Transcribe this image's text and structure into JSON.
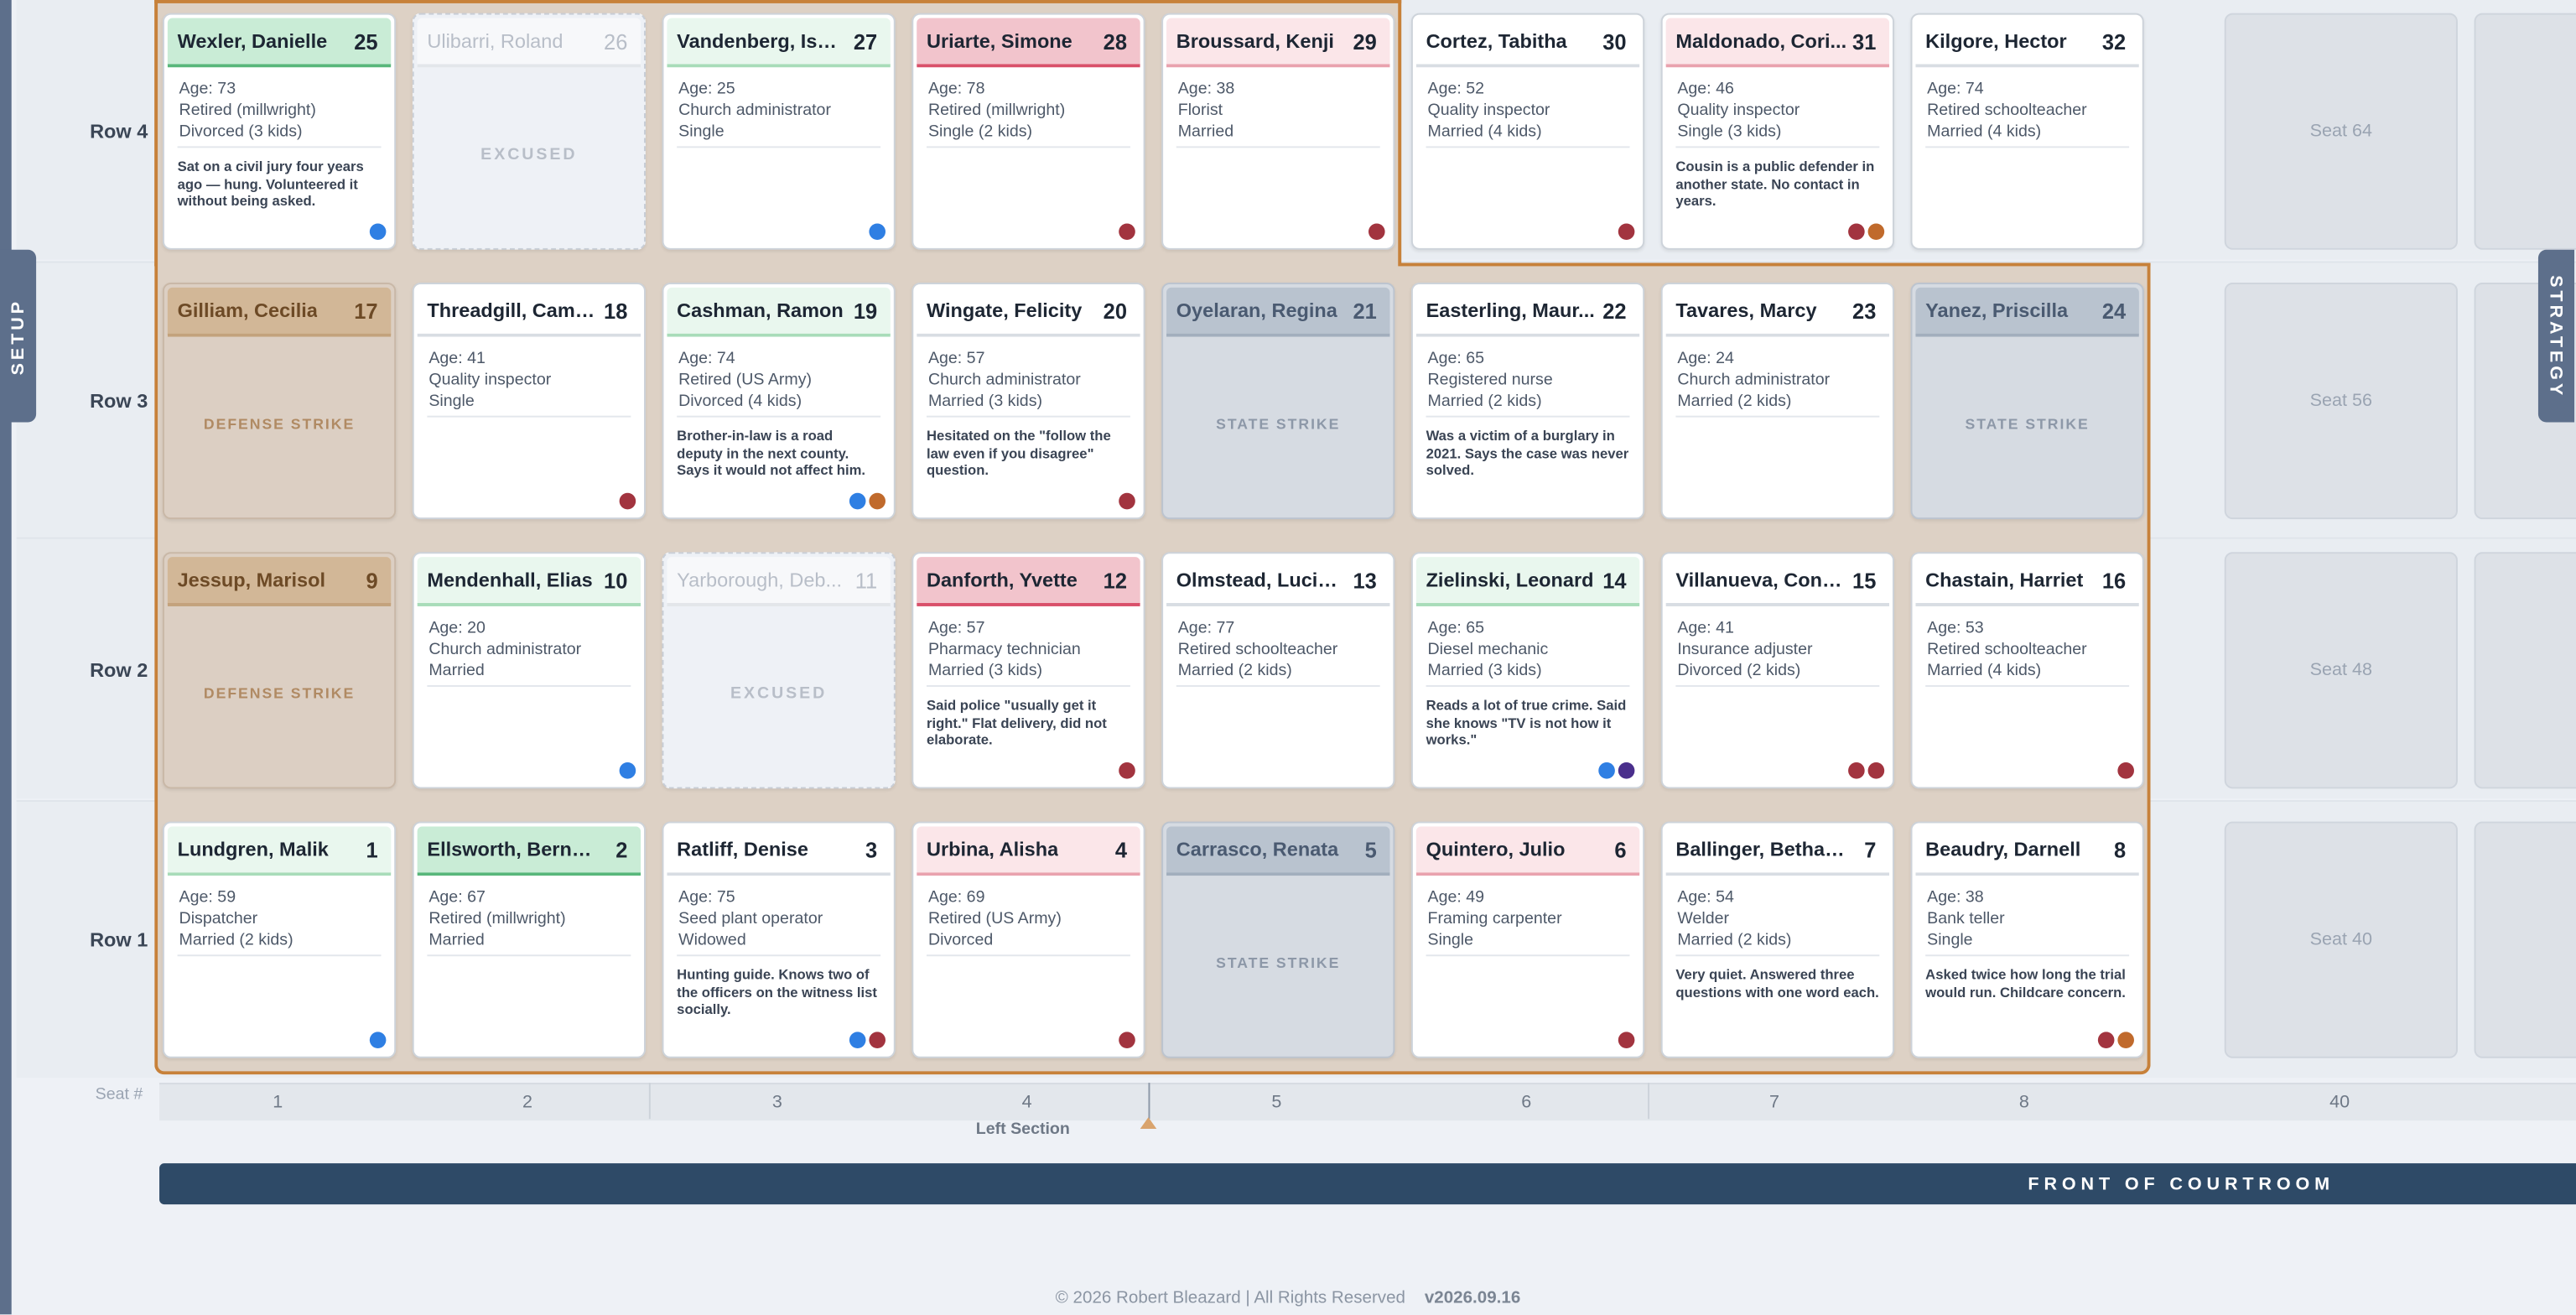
{
  "side_tabs": {
    "setup": "SETUP",
    "strategy": "STRATEGY"
  },
  "rows": [
    "Row 4",
    "Row 3",
    "Row 2",
    "Row 1"
  ],
  "seat_header": "Seat #",
  "section_label": "Left Section",
  "front_label": "FRONT OF COURTROOM",
  "footer": {
    "copyright": "© 2026 Robert Bleazard | All Rights Reserved",
    "version": "v2026.09.16"
  },
  "strike_labels": {
    "defense": "DEFENSE STRIKE",
    "state": "STATE STRIKE",
    "excused": "EXCUSED"
  },
  "dot_colors": {
    "blue": "#2f7fe3",
    "red": "#a2343f",
    "orange": "#c06a2c",
    "purple": "#4a2f8c"
  },
  "seat_columns": [
    "1",
    "2",
    "3",
    "4",
    "5",
    "6",
    "7",
    "8",
    "40"
  ],
  "empty_seats": [
    {
      "label": "Seat 64"
    },
    {
      "label": "Seat 56"
    },
    {
      "label": "Seat 48"
    },
    {
      "label": "Seat 40"
    }
  ],
  "jurors": [
    {
      "name": "Wexler, Danielle",
      "num": "25",
      "status": "normal",
      "color": "green",
      "age": "Age: 73",
      "job": "Retired (millwright)",
      "family": "Divorced (3 kids)",
      "note": "Sat on a civil jury four years ago — hung. Volunteered it without being asked.",
      "dots": [
        "blue"
      ]
    },
    {
      "name": "Ulibarri, Roland",
      "num": "26",
      "status": "excused"
    },
    {
      "name": "Vandenberg, Isai...",
      "num": "27",
      "status": "normal",
      "color": "lgreen",
      "age": "Age: 25",
      "job": "Church administrator",
      "family": "Single",
      "note": "",
      "dots": [
        "blue"
      ]
    },
    {
      "name": "Uriarte, Simone",
      "num": "28",
      "status": "normal",
      "color": "red",
      "age": "Age: 78",
      "job": "Retired (millwright)",
      "family": "Single (2 kids)",
      "note": "",
      "dots": [
        "red"
      ]
    },
    {
      "name": "Broussard, Kenji",
      "num": "29",
      "status": "normal",
      "color": "pink",
      "age": "Age: 38",
      "job": "Florist",
      "family": "Married",
      "note": "",
      "dots": [
        "red"
      ]
    },
    {
      "name": "Cortez, Tabitha",
      "num": "30",
      "status": "normal",
      "color": "white",
      "age": "Age: 52",
      "job": "Quality inspector",
      "family": "Married (4 kids)",
      "note": "",
      "dots": [
        "red"
      ]
    },
    {
      "name": "Maldonado, Cori...",
      "num": "31",
      "status": "normal",
      "color": "pink",
      "age": "Age: 46",
      "job": "Quality inspector",
      "family": "Single (3 kids)",
      "note": "Cousin is a public defender in another state. No contact in years.",
      "dots": [
        "red",
        "orange"
      ]
    },
    {
      "name": "Kilgore, Hector",
      "num": "32",
      "status": "normal",
      "color": "white",
      "age": "Age: 74",
      "job": "Retired schoolteacher",
      "family": "Married (4 kids)",
      "note": "",
      "dots": []
    },
    {
      "name": "Gilliam, Cecilia",
      "num": "17",
      "status": "defense"
    },
    {
      "name": "Threadgill, Camille",
      "num": "18",
      "status": "normal",
      "color": "white",
      "age": "Age: 41",
      "job": "Quality inspector",
      "family": "Single",
      "note": "",
      "dots": [
        "red"
      ]
    },
    {
      "name": "Cashman, Ramon",
      "num": "19",
      "status": "normal",
      "color": "lgreen",
      "age": "Age: 74",
      "job": "Retired (US Army)",
      "family": "Divorced (4 kids)",
      "note": "Brother-in-law is a road deputy in the next county. Says it would not affect him.",
      "dots": [
        "blue",
        "orange"
      ]
    },
    {
      "name": "Wingate, Felicity",
      "num": "20",
      "status": "normal",
      "color": "white",
      "age": "Age: 57",
      "job": "Church administrator",
      "family": "Married (3 kids)",
      "note": "Hesitated on the \"follow the law even if you disagree\" question.",
      "dots": [
        "red"
      ]
    },
    {
      "name": "Oyelaran, Regina",
      "num": "21",
      "status": "state"
    },
    {
      "name": "Easterling, Maur...",
      "num": "22",
      "status": "normal",
      "color": "white",
      "age": "Age: 65",
      "job": "Registered nurse",
      "family": "Married (2 kids)",
      "note": "Was a victim of a burglary in 2021. Says the case was never solved.",
      "dots": []
    },
    {
      "name": "Tavares, Marcy",
      "num": "23",
      "status": "normal",
      "color": "white",
      "age": "Age: 24",
      "job": "Church administrator",
      "family": "Married (2 kids)",
      "note": "",
      "dots": []
    },
    {
      "name": "Yanez, Priscilla",
      "num": "24",
      "status": "state"
    },
    {
      "name": "Jessup, Marisol",
      "num": "9",
      "status": "defense"
    },
    {
      "name": "Mendenhall, Elias",
      "num": "10",
      "status": "normal",
      "color": "lgreen",
      "age": "Age: 20",
      "job": "Church administrator",
      "family": "Married",
      "note": "",
      "dots": [
        "blue"
      ]
    },
    {
      "name": "Yarborough, Deb...",
      "num": "11",
      "status": "excused"
    },
    {
      "name": "Danforth, Yvette",
      "num": "12",
      "status": "normal",
      "color": "red",
      "age": "Age: 57",
      "job": "Pharmacy technician",
      "family": "Married (3 kids)",
      "note": "Said police \"usually get it right.\" Flat delivery, did not elaborate.",
      "dots": [
        "red"
      ]
    },
    {
      "name": "Olmstead, Lucinda",
      "num": "13",
      "status": "normal",
      "color": "white",
      "age": "Age: 77",
      "job": "Retired schoolteacher",
      "family": "Married (2 kids)",
      "note": "",
      "dots": []
    },
    {
      "name": "Zielinski, Leonard",
      "num": "14",
      "status": "normal",
      "color": "lgreen",
      "age": "Age: 65",
      "job": "Diesel mechanic",
      "family": "Married (3 kids)",
      "note": "Reads a lot of true crime. Said she knows \"TV is not how it works.\"",
      "dots": [
        "blue",
        "purple"
      ]
    },
    {
      "name": "Villanueva, Cons...",
      "num": "15",
      "status": "normal",
      "color": "white",
      "age": "Age: 41",
      "job": "Insurance adjuster",
      "family": "Divorced (2 kids)",
      "note": "",
      "dots": [
        "red",
        "red"
      ]
    },
    {
      "name": "Chastain, Harriet",
      "num": "16",
      "status": "normal",
      "color": "white",
      "age": "Age: 53",
      "job": "Retired schoolteacher",
      "family": "Married (4 kids)",
      "note": "",
      "dots": [
        "red"
      ]
    },
    {
      "name": "Lundgren, Malik",
      "num": "1",
      "status": "normal",
      "color": "lgreen",
      "age": "Age: 59",
      "job": "Dispatcher",
      "family": "Married (2 kids)",
      "note": "",
      "dots": [
        "blue"
      ]
    },
    {
      "name": "Ellsworth, Bernard",
      "num": "2",
      "status": "normal",
      "color": "green",
      "age": "Age: 67",
      "job": "Retired (millwright)",
      "family": "Married",
      "note": "",
      "dots": []
    },
    {
      "name": "Ratliff, Denise",
      "num": "3",
      "status": "normal",
      "color": "white",
      "age": "Age: 75",
      "job": "Seed plant operator",
      "family": "Widowed",
      "note": "Hunting guide. Knows two of the officers on the witness list socially.",
      "dots": [
        "blue",
        "red"
      ]
    },
    {
      "name": "Urbina, Alisha",
      "num": "4",
      "status": "normal",
      "color": "pink",
      "age": "Age: 69",
      "job": "Retired (US Army)",
      "family": "Divorced",
      "note": "",
      "dots": [
        "red"
      ]
    },
    {
      "name": "Carrasco, Renata",
      "num": "5",
      "status": "state"
    },
    {
      "name": "Quintero, Julio",
      "num": "6",
      "status": "normal",
      "color": "pink",
      "age": "Age: 49",
      "job": "Framing carpenter",
      "family": "Single",
      "note": "",
      "dots": [
        "red"
      ]
    },
    {
      "name": "Ballinger, Bethany",
      "num": "7",
      "status": "normal",
      "color": "white",
      "age": "Age: 54",
      "job": "Welder",
      "family": "Married (2 kids)",
      "note": "Very quiet. Answered three questions with one word each.",
      "dots": []
    },
    {
      "name": "Beaudry, Darnell",
      "num": "8",
      "status": "normal",
      "color": "white",
      "age": "Age: 38",
      "job": "Bank teller",
      "family": "Single",
      "note": "Asked twice how long the trial would run. Childcare concern.",
      "dots": [
        "red",
        "orange"
      ]
    }
  ]
}
